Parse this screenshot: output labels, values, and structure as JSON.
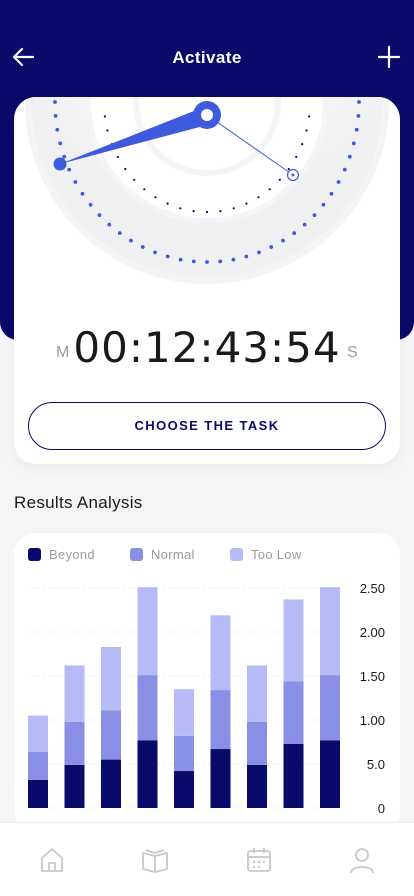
{
  "header": {
    "title": "Activate",
    "back_icon": "arrow-left-icon",
    "add_icon": "plus-icon"
  },
  "colors": {
    "navy": "#0a0a6a",
    "accent": "#3d5bdc",
    "normal": "#8a8fe6",
    "too_low": "#b7bbf5"
  },
  "timer": {
    "left_label": "M",
    "right_label": "S",
    "time": "00:12:43:54"
  },
  "choose_button": {
    "label": "CHOOSE THE TASK"
  },
  "results": {
    "title": "Results Analysis"
  },
  "chart_data": {
    "type": "bar",
    "stacked": true,
    "categories": [
      "",
      "",
      "",
      "",
      "",
      "",
      "",
      "",
      ""
    ],
    "series": [
      {
        "name": "Beyond",
        "color": "#0a0a6a",
        "values": [
          0.32,
          0.49,
          0.55,
          0.77,
          0.42,
          0.67,
          0.49,
          0.73,
          0.77
        ]
      },
      {
        "name": "Normal",
        "color": "#8a8fe6",
        "values": [
          0.32,
          0.49,
          0.56,
          0.74,
          0.4,
          0.67,
          0.49,
          0.71,
          0.74
        ]
      },
      {
        "name": "Too Low",
        "color": "#b7bbf5",
        "values": [
          0.41,
          0.64,
          0.72,
          1.0,
          0.53,
          0.85,
          0.64,
          0.93,
          1.0
        ]
      }
    ],
    "y_tick_labels": [
      "0",
      "5.0",
      "1.00",
      "1.50",
      "2.00",
      "2.50"
    ],
    "ylim": [
      0,
      2.5
    ],
    "grid": true,
    "legend_position": "top"
  },
  "tabbar": {
    "items": [
      {
        "icon": "home-icon"
      },
      {
        "icon": "book-icon"
      },
      {
        "icon": "calendar-icon"
      },
      {
        "icon": "profile-icon"
      }
    ]
  }
}
